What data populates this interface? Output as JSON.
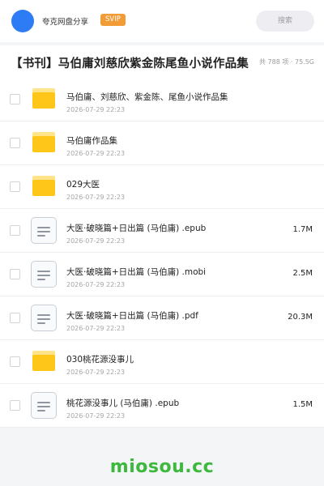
{
  "header": {
    "site_name": "夸克网盘分享",
    "badge": "SVIP",
    "search_label": "搜索",
    "avatar_color": "#2d7cf6"
  },
  "title_bar": {
    "title": "【书刊】马伯庸刘慈欣紫金陈尾鱼小说作品集",
    "meta": "共 788 项 · 75.5G"
  },
  "files": [
    {
      "icon": "folder-icon",
      "name": "马伯庸、刘慈欣、紫金陈、尾鱼小说作品集",
      "date": "2026-07-29 22:23",
      "size": ""
    },
    {
      "icon": "folder-icon",
      "name": "马伯庸作品集",
      "date": "2026-07-29 22:23",
      "size": ""
    },
    {
      "icon": "folder-icon",
      "name": "029大医",
      "date": "2026-07-29 22:23",
      "size": ""
    },
    {
      "icon": "document-icon",
      "name": "大医·破晓篇+日出篇 (马伯庸) .epub",
      "date": "2026-07-29 22:23",
      "size": "1.7M"
    },
    {
      "icon": "document-icon",
      "name": "大医·破晓篇+日出篇 (马伯庸) .mobi",
      "date": "2026-07-29 22:23",
      "size": "2.5M"
    },
    {
      "icon": "document-icon",
      "name": "大医·破晓篇+日出篇 (马伯庸) .pdf",
      "date": "2026-07-29 22:23",
      "size": "20.3M"
    },
    {
      "icon": "folder-icon",
      "name": "030桃花源没事儿",
      "date": "2026-07-29 22:23",
      "size": ""
    },
    {
      "icon": "document-icon",
      "name": "桃花源没事儿 (马伯庸) .epub",
      "date": "2026-07-29 22:23",
      "size": "1.5M"
    }
  ],
  "watermark": "miosou.cc",
  "colors": {
    "badge": "#f29c38",
    "folder": "#ffc61a",
    "watermark": "#3cb83c"
  }
}
